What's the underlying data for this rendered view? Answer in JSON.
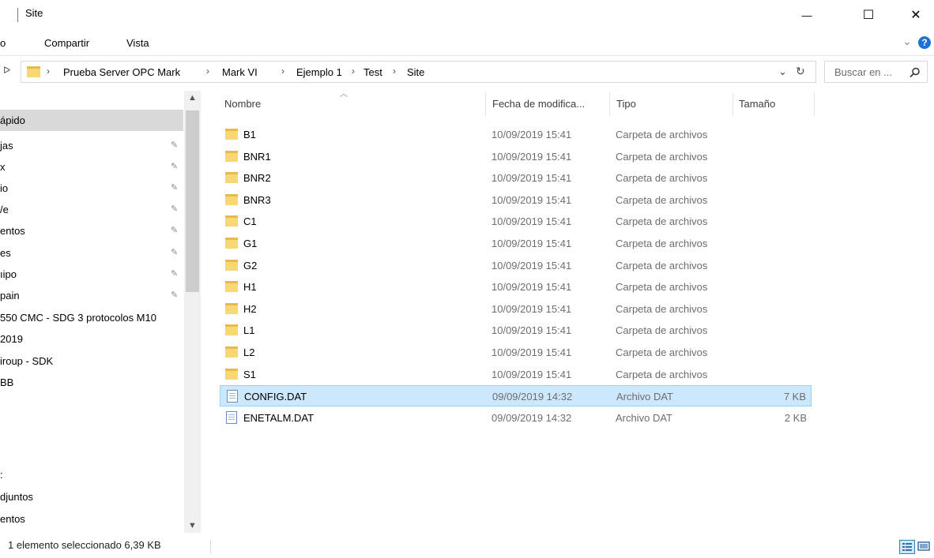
{
  "window": {
    "title": "Site",
    "minimize_glyph": "—",
    "maximize_glyph": "☐",
    "close_glyph": "✕"
  },
  "ribbon": {
    "tabs": [
      "o",
      "Compartir",
      "Vista"
    ],
    "collapse_glyph": "⌄",
    "help_glyph": "?"
  },
  "address": {
    "back_glyph": "ᐅ",
    "crumbs": [
      "Prueba Server OPC Mark",
      "Mark VI",
      "Ejemplo 1",
      "Test",
      "Site"
    ],
    "sep_glyph": "›",
    "dropdown_glyph": "⌄",
    "refresh_glyph": "↻"
  },
  "search": {
    "placeholder": "Buscar en ...",
    "icon": "search-icon"
  },
  "nav": {
    "items": [
      {
        "label": "ápido",
        "pinned": false,
        "selected": true
      },
      {
        "label": "jas",
        "pinned": true
      },
      {
        "label": "x",
        "pinned": true
      },
      {
        "label": "io",
        "pinned": true
      },
      {
        "label": "/e",
        "pinned": true
      },
      {
        "label": "entos",
        "pinned": true
      },
      {
        "label": "es",
        "pinned": true
      },
      {
        "label": "ıipo",
        "pinned": true
      },
      {
        "label": "pain",
        "pinned": true
      },
      {
        "label": "550 CMC - SDG 3 protocolos M10",
        "pinned": false
      },
      {
        "label": "2019",
        "pinned": false
      },
      {
        "label": "iroup - SDK",
        "pinned": false
      },
      {
        "label": "BB",
        "pinned": false
      },
      {
        "label": "",
        "pinned": false
      },
      {
        "label": "",
        "pinned": false
      },
      {
        "label": ":",
        "pinned": false
      },
      {
        "label": "djuntos",
        "pinned": false
      },
      {
        "label": "entos",
        "pinned": false
      }
    ],
    "pin_glyph": "✎"
  },
  "columns": {
    "name": "Nombre",
    "date": "Fecha de modifica...",
    "type": "Tipo",
    "size": "Tamaño"
  },
  "files": [
    {
      "name": "B1",
      "date": "10/09/2019 15:41",
      "type": "Carpeta de archivos",
      "size": "",
      "icon": "folder-icon"
    },
    {
      "name": "BNR1",
      "date": "10/09/2019 15:41",
      "type": "Carpeta de archivos",
      "size": "",
      "icon": "folder-icon"
    },
    {
      "name": "BNR2",
      "date": "10/09/2019 15:41",
      "type": "Carpeta de archivos",
      "size": "",
      "icon": "folder-icon"
    },
    {
      "name": "BNR3",
      "date": "10/09/2019 15:41",
      "type": "Carpeta de archivos",
      "size": "",
      "icon": "folder-icon"
    },
    {
      "name": "C1",
      "date": "10/09/2019 15:41",
      "type": "Carpeta de archivos",
      "size": "",
      "icon": "folder-icon"
    },
    {
      "name": "G1",
      "date": "10/09/2019 15:41",
      "type": "Carpeta de archivos",
      "size": "",
      "icon": "folder-icon"
    },
    {
      "name": "G2",
      "date": "10/09/2019 15:41",
      "type": "Carpeta de archivos",
      "size": "",
      "icon": "folder-icon"
    },
    {
      "name": "H1",
      "date": "10/09/2019 15:41",
      "type": "Carpeta de archivos",
      "size": "",
      "icon": "folder-icon"
    },
    {
      "name": "H2",
      "date": "10/09/2019 15:41",
      "type": "Carpeta de archivos",
      "size": "",
      "icon": "folder-icon"
    },
    {
      "name": "L1",
      "date": "10/09/2019 15:41",
      "type": "Carpeta de archivos",
      "size": "",
      "icon": "folder-icon"
    },
    {
      "name": "L2",
      "date": "10/09/2019 15:41",
      "type": "Carpeta de archivos",
      "size": "",
      "icon": "folder-icon"
    },
    {
      "name": "S1",
      "date": "10/09/2019 15:41",
      "type": "Carpeta de archivos",
      "size": "",
      "icon": "folder-icon"
    },
    {
      "name": "CONFIG.DAT",
      "date": "09/09/2019 14:32",
      "type": "Archivo DAT",
      "size": "7 KB",
      "icon": "dat-file-icon",
      "selected": true
    },
    {
      "name": "ENETALM.DAT",
      "date": "09/09/2019 14:32",
      "type": "Archivo DAT",
      "size": "2 KB",
      "icon": "dat-file-icon"
    }
  ],
  "status": {
    "text": "1 elemento seleccionado  6,39 KB"
  },
  "colors": {
    "selection_bg": "#cce8ff",
    "selection_border": "#99d1ff",
    "nav_selected": "#d9d9d9",
    "folder": "#f8d775",
    "help": "#1e73d2"
  }
}
